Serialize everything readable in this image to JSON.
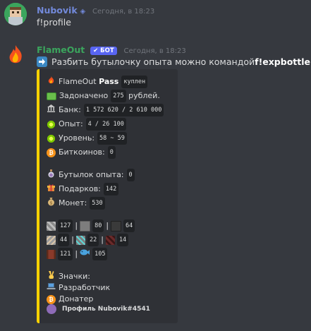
{
  "messages": [
    {
      "username": "Nubovik",
      "timestamp": "Сегодня, в 18:23",
      "text": "f!profile"
    },
    {
      "username": "FlameOut",
      "bot_label": "✔ БОТ",
      "timestamp": "Сегодня, в 18:23",
      "text_prefix": "Разбить бутылочку опыта можно командой ",
      "text_bold": "f!expbottle"
    }
  ],
  "embed": {
    "accent": "#ffd200",
    "pass_label": "FlameOut",
    "pass_bold": "Pass",
    "pass_status": "куплен",
    "donated_label": "Задоначено",
    "donated_value": "275",
    "donated_unit": "рублей.",
    "bank_label": "Банк:",
    "bank_value": "1 572 620 / 2 610 000",
    "exp_label": "Опыт:",
    "exp_value": "4 / 26 100",
    "level_label": "Уровень:",
    "level_value": "58 ~ 59",
    "bitcoins_label": "Биткоинов:",
    "bitcoins_value": "0",
    "bottles_label": "Бутылок опыта:",
    "bottles_value": "0",
    "gifts_label": "Подарков:",
    "gifts_value": "142",
    "coins_label": "Монет:",
    "coins_value": "530",
    "inventory": {
      "row1": [
        "127",
        "80",
        "64"
      ],
      "row2": [
        "44",
        "22",
        "14"
      ],
      "row3": [
        "121",
        "105"
      ]
    },
    "badges_label": "Значки:",
    "badges": [
      "Разработчик",
      "Донатер"
    ],
    "footer": "Профиль Nubovik#4541"
  }
}
